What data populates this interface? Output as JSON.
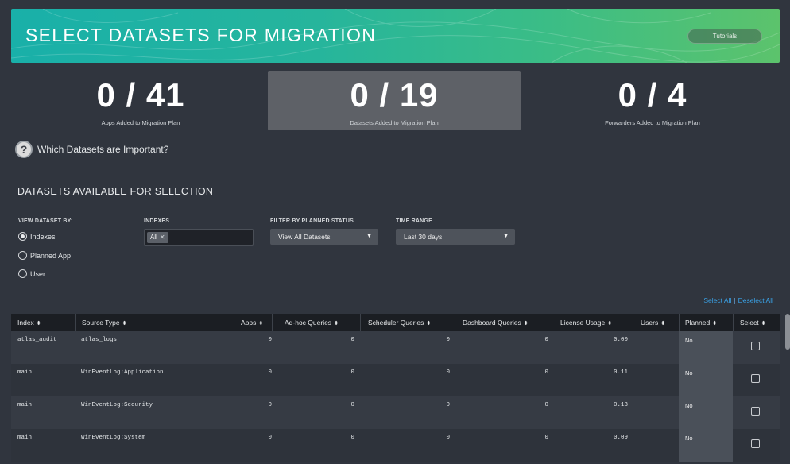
{
  "banner": {
    "title": "SELECT DATASETS FOR MIGRATION",
    "tutorials_label": "Tutorials"
  },
  "stats": [
    {
      "value": "0 / 41",
      "label": "Apps Added to Migration Plan"
    },
    {
      "value": "0 / 19",
      "label": "Datasets Added to Migration Plan"
    },
    {
      "value": "0 / 4",
      "label": "Forwarders Added to Migration Plan"
    }
  ],
  "help": {
    "icon": "question-circle-icon",
    "text": "Which Datasets are Important?"
  },
  "section_title": "DATASETS AVAILABLE FOR SELECTION",
  "filters": {
    "view_by": {
      "label": "VIEW DATASET BY:",
      "options": [
        "Indexes",
        "Planned App",
        "User"
      ],
      "selected": "Indexes"
    },
    "indexes": {
      "label": "INDEXES",
      "tokens": [
        "All"
      ]
    },
    "planned_status": {
      "label": "FILTER BY PLANNED STATUS",
      "value": "View All Datasets"
    },
    "time_range": {
      "label": "TIME RANGE",
      "value": "Last 30 days"
    }
  },
  "links": {
    "select_all": "Select All",
    "separator": "|",
    "deselect_all": "Deselect All"
  },
  "table": {
    "sort_icon": "sort-icon",
    "columns": [
      "Index",
      "Source Type",
      "Apps",
      "Ad-hoc Queries",
      "Scheduler Queries",
      "Dashboard Queries",
      "License Usage",
      "Users",
      "Planned",
      "Select"
    ],
    "rows": [
      {
        "index": "atlas_audit",
        "source_type": "atlas_logs",
        "apps": "0",
        "adhoc": "0",
        "scheduler": "0",
        "dashboard": "0",
        "license": "0.00",
        "users": "",
        "planned": "No"
      },
      {
        "index": "main",
        "source_type": "WinEventLog:Application",
        "apps": "0",
        "adhoc": "0",
        "scheduler": "0",
        "dashboard": "0",
        "license": "0.11",
        "users": "",
        "planned": "No"
      },
      {
        "index": "main",
        "source_type": "WinEventLog:Security",
        "apps": "0",
        "adhoc": "0",
        "scheduler": "0",
        "dashboard": "0",
        "license": "0.13",
        "users": "",
        "planned": "No"
      },
      {
        "index": "main",
        "source_type": "WinEventLog:System",
        "apps": "0",
        "adhoc": "0",
        "scheduler": "0",
        "dashboard": "0",
        "license": "0.09",
        "users": "",
        "planned": "No"
      }
    ]
  }
}
